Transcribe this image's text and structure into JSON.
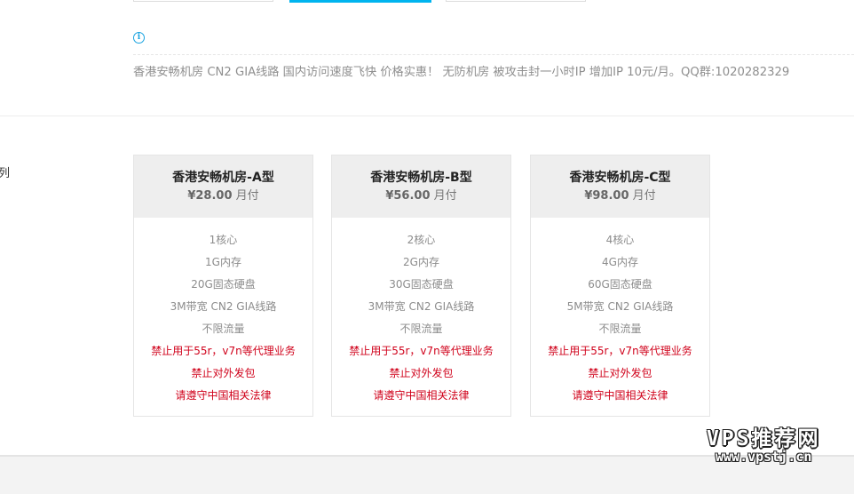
{
  "notice": {
    "icon": "info-icon",
    "text": "香港安畅机房 CN2 GIA线路 国内访问速度飞快 价格实惠！  无防机房 被攻击封一小时IP 增加IP 10元/月。QQ群:1020282329"
  },
  "sidebar": {
    "label": "列"
  },
  "colors": {
    "accent": "#00b4ef",
    "warning": "#d0021b"
  },
  "products": [
    {
      "title": "香港安畅机房-A型",
      "price": "¥28.00",
      "cycle": "月付",
      "features": [
        "1核心",
        "1G内存",
        "20G固态硬盘",
        "3M带宽 CN2 GIA线路",
        "不限流量"
      ],
      "warnings": [
        "禁止用于55r，v7n等代理业务",
        "禁止对外发包",
        "请遵守中国相关法律"
      ]
    },
    {
      "title": "香港安畅机房-B型",
      "price": "¥56.00",
      "cycle": "月付",
      "features": [
        "2核心",
        "2G内存",
        "30G固态硬盘",
        "3M带宽 CN2 GIA线路",
        "不限流量"
      ],
      "warnings": [
        "禁止用于55r，v7n等代理业务",
        "禁止对外发包",
        "请遵守中国相关法律"
      ]
    },
    {
      "title": "香港安畅机房-C型",
      "price": "¥98.00",
      "cycle": "月付",
      "features": [
        "4核心",
        "4G内存",
        "60G固态硬盘",
        "5M带宽 CN2 GIA线路",
        "不限流量"
      ],
      "warnings": [
        "禁止用于55r，v7n等代理业务",
        "禁止对外发包",
        "请遵守中国相关法律"
      ]
    }
  ],
  "watermark": {
    "title": "VPS推荐网",
    "url": "www.vpstj.cn"
  }
}
